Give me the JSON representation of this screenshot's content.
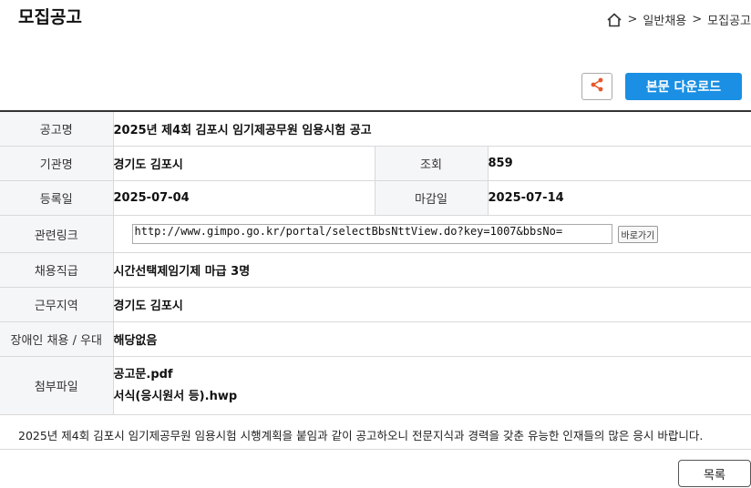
{
  "page": {
    "title": "모집공고"
  },
  "breadcrumb": {
    "home_icon": "home-icon",
    "items": [
      "일반채용",
      "모집공고"
    ],
    "separator": ">"
  },
  "actions": {
    "share_icon": "share-icon",
    "download_label": "본문 다운로드"
  },
  "info": {
    "title_label": "공고명",
    "title_value": "2025년 제4회 김포시 임기제공무원 임용시험 공고",
    "org_label": "기관명",
    "org_value": "경기도 김포시",
    "views_label": "조회",
    "views_value": "859",
    "reg_label": "등록일",
    "reg_value": "2025-07-04",
    "deadline_label": "마감일",
    "deadline_value": "2025-07-14",
    "link_label": "관련링크",
    "link_value": "http://www.gimpo.go.kr/portal/selectBbsNttView.do?key=1007&bbsNo=",
    "link_go": "바로가기",
    "job_label": "채용직급",
    "job_value": "시간선택제임기제 마급 3명",
    "area_label": "근무지역",
    "area_value": "경기도 김포시",
    "disabled_label": "장애인 채용 / 우대",
    "disabled_value": "해당없음",
    "files_label": "첨부파일",
    "files": [
      "공고문.pdf",
      "서식(응시원서 등).hwp"
    ]
  },
  "notice": "2025년 제4회 김포시 임기제공무원 임용시험 시행계획을 붙임과 같이 공고하오니 전문지식과 경력을 갖춘 유능한 인재들의 많은 응시 바랍니다.",
  "footer": {
    "list_label": "목록"
  },
  "colors": {
    "accent": "#1a8fe3",
    "share": "#e8572a"
  }
}
